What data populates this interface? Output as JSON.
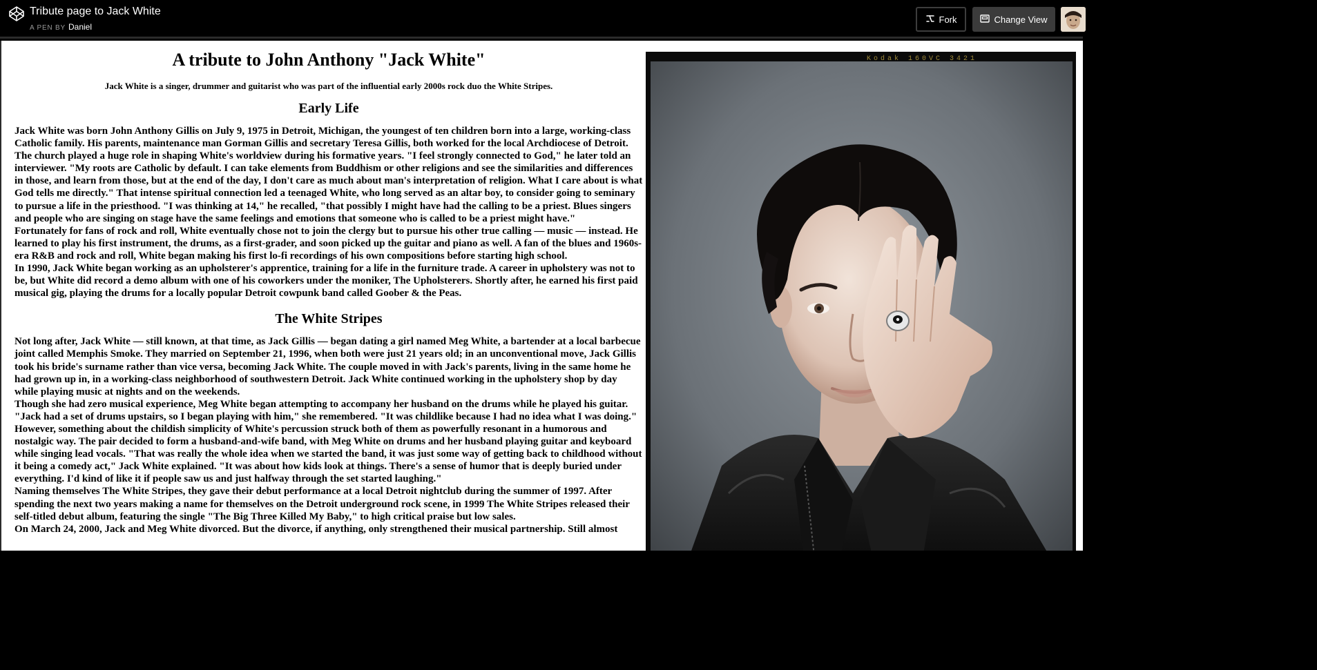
{
  "topbar": {
    "pen_title": "Tribute page to Jack White",
    "pen_by_label": "A PEN BY",
    "author": "Daniel",
    "fork_label": "Fork",
    "change_view_label": "Change View",
    "icons": {
      "logo": "codepen-logo-icon",
      "fork": "fork-icon",
      "change_view": "layout-icon"
    }
  },
  "tribute": {
    "title": "A tribute to John Anthony \"Jack White\"",
    "subtitle": "Jack White is a singer, drummer and guitarist who was part of the influential early 2000s rock duo the White Stripes.",
    "early_life_heading": "Early Life",
    "early_life_paragraphs": [
      "Jack White was born John Anthony Gillis on July 9, 1975 in Detroit, Michigan, the youngest of ten children born into a large, working-class Catholic family. His parents, maintenance man Gorman Gillis and secretary Teresa Gillis, both worked for the local Archdiocese of Detroit. The church played a huge role in shaping White's worldview during his formative years. \"I feel strongly connected to God,\" he later told an interviewer. \"My roots are Catholic by default. I can take elements from Buddhism or other religions and see the similarities and differences in those, and learn from those, but at the end of the day, I don't care as much about man's interpretation of religion. What I care about is what God tells me directly.\" That intense spiritual connection led a teenaged White, who long served as an altar boy, to consider going to seminary to pursue a life in the priesthood. \"I was thinking at 14,\" he recalled, \"that possibly I might have had the calling to be a priest. Blues singers and people who are singing on stage have the same feelings and emotions that someone who is called to be a priest might have.\"",
      "Fortunately for fans of rock and roll, White eventually chose not to join the clergy but to pursue his other true calling — music — instead. He learned to play his first instrument, the drums, as a first-grader, and soon picked up the guitar and piano as well. A fan of the blues and 1960s-era R&B and rock and roll, White began making his first lo-fi recordings of his own compositions before starting high school.",
      "In 1990, Jack White began working as an upholsterer's apprentice, training for a life in the furniture trade. A career in upholstery was not to be, but White did record a demo album with one of his coworkers under the moniker, The Upholsterers. Shortly after, he earned his first paid musical gig, playing the drums for a locally popular Detroit cowpunk band called Goober & the Peas."
    ],
    "white_stripes_heading": "The White Stripes",
    "white_stripes_paragraphs": [
      "Not long after, Jack White — still known, at that time, as Jack Gillis — began dating a girl named Meg White, a bartender at a local barbecue joint called Memphis Smoke. They married on September 21, 1996, when both were just 21 years old; in an unconventional move, Jack Gillis took his bride's surname rather than vice versa, becoming Jack White. The couple moved in with Jack's parents, living in the same home he had grown up in, in a working-class neighborhood of southwestern Detroit. Jack White continued working in the upholstery shop by day while playing music at nights and on the weekends.",
      "Though she had zero musical experience, Meg White began attempting to accompany her husband on the drums while he played his guitar. \"Jack had a set of drums upstairs, so I began playing with him,\" she remembered. \"It was childlike because I had no idea what I was doing.\" However, something about the childish simplicity of White's percussion struck both of them as powerfully resonant in a humorous and nostalgic way. The pair decided to form a husband-and-wife band, with Meg White on drums and her husband playing guitar and keyboard while singing lead vocals. \"That was really the whole idea when we started the band, it was just some way of getting back to childhood without it being a comedy act,\" Jack White explained. \"It was about how kids look at things. There's a sense of humor that is deeply buried under everything. I'd kind of like it if people saw us and just halfway through the set started laughing.\"",
      "Naming themselves The White Stripes, they gave their debut performance at a local Detroit nightclub during the summer of 1997. After spending the next two years making a name for themselves on the Detroit underground rock scene, in 1999 The White Stripes released their self-titled debut album, featuring the single \"The Big Three Killed My Baby,\" to high critical praise but low sales.",
      "On March 24, 2000, Jack and Meg White divorced. But the divorce, if anything, only strengthened their musical partnership. Still almost"
    ],
    "photo": {
      "film_edge_text": "Kodak 160VC 3421",
      "description_icon": "portrait-photo"
    }
  }
}
